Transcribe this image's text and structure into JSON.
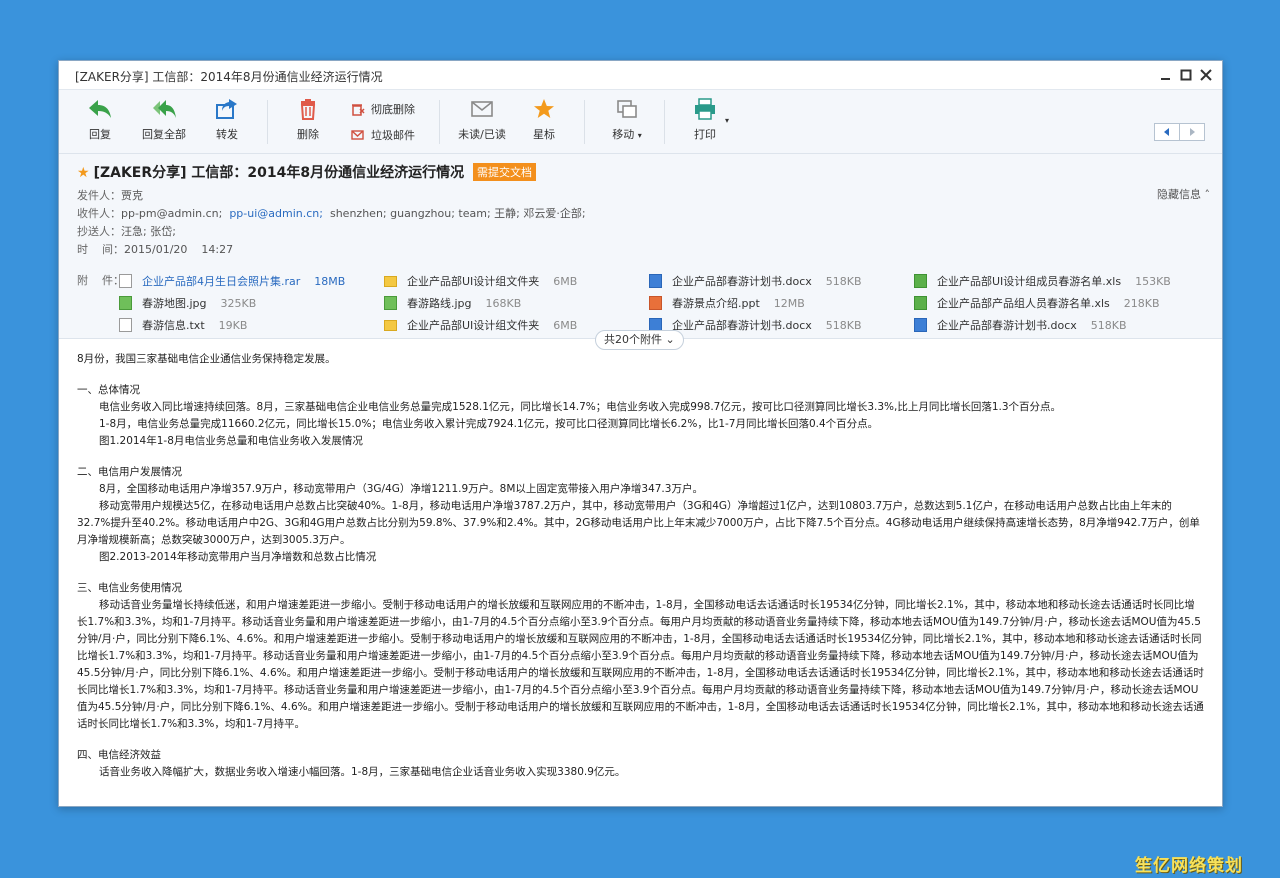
{
  "window": {
    "title": "[ZAKER分享] 工信部：2014年8月份通信业经济运行情况"
  },
  "toolbar": {
    "reply": "回复",
    "reply_all": "回复全部",
    "forward": "转发",
    "delete": "删除",
    "permanent_delete": "彻底删除",
    "junk": "垃圾邮件",
    "unread_read": "未读/已读",
    "star": "星标",
    "move": "移动",
    "print": "打印"
  },
  "mail": {
    "subject": "[ZAKER分享] 工信部：2014年8月份通信业经济运行情况",
    "badge": "需提交文档",
    "hide_info": "隐藏信息",
    "from_label": "发件人：",
    "from": "贾克",
    "to_label": "收件人：",
    "to_1": "pp-pm@admin.cn;",
    "to_2": "pp-ui@admin.cn;",
    "to_rest": "shenzhen;  guangzhou;  team;  王静;  邓云爱·企部;",
    "cc_label": "抄送人：",
    "cc": "汪急;  张岱;",
    "time_label": "时    间：",
    "time": "2015/01/20    14:27",
    "attach_label": "附    件：",
    "attachments_more": "共20个附件"
  },
  "attachments": [
    {
      "name": "企业产品部4月生日会照片集.rar",
      "size": "18MB",
      "type": "rar"
    },
    {
      "name": "企业产品部UI设计组文件夹",
      "size": "6MB",
      "type": "folder"
    },
    {
      "name": "企业产品部春游计划书.docx",
      "size": "518KB",
      "type": "word"
    },
    {
      "name": "企业产品部UI设计组成员春游名单.xls",
      "size": "153KB",
      "type": "excel"
    },
    {
      "name": "春游地图.jpg",
      "size": "325KB",
      "type": "image"
    },
    {
      "name": "春游路线.jpg",
      "size": "168KB",
      "type": "image"
    },
    {
      "name": "春游景点介绍.ppt",
      "size": "12MB",
      "type": "ppt"
    },
    {
      "name": "企业产品部产品组人员春游名单.xls",
      "size": "218KB",
      "type": "excel"
    },
    {
      "name": "春游信息.txt",
      "size": "19KB",
      "type": "text"
    },
    {
      "name": "企业产品部UI设计组文件夹",
      "size": "6MB",
      "type": "folder"
    },
    {
      "name": "企业产品部春游计划书.docx",
      "size": "518KB",
      "type": "word"
    },
    {
      "name": "企业产品部春游计划书.docx",
      "size": "518KB",
      "type": "word"
    }
  ],
  "body": {
    "intro": "8月份，我国三家基础电信企业通信业务保持稳定发展。",
    "s1_title": "一、总体情况",
    "s1_p1": "电信业务收入同比增速持续回落。8月，三家基础电信企业电信业务总量完成1528.1亿元，同比增长14.7%；电信业务收入完成998.7亿元，按可比口径测算同比增长3.3%,比上月同比增长回落1.3个百分点。",
    "s1_p2": "1-8月，电信业务总量完成11660.2亿元，同比增长15.0%；电信业务收入累计完成7924.1亿元，按可比口径测算同比增长6.2%，比1-7月同比增长回落0.4个百分点。",
    "s1_fig": "图1.2014年1-8月电信业务总量和电信业务收入发展情况",
    "s2_title": "二、电信用户发展情况",
    "s2_p1": "8月，全国移动电话用户净增357.9万户，移动宽带用户（3G/4G）净增1211.9万户。8M以上固定宽带接入用户净增347.3万户。",
    "s2_p2": "移动宽带用户规模达5亿，在移动电话用户总数占比突破40%。1-8月，移动电话用户净增3787.2万户，其中，移动宽带用户（3G和4G）净增超过1亿户，达到10803.7万户，总数达到5.1亿户，在移动电话用户总数占比由上年末的32.7%提升至40.2%。移动电话用户中2G、3G和4G用户总数占比分别为59.8%、37.9%和2.4%。其中，2G移动电话用户比上年末减少7000万户，占比下降7.5个百分点。4G移动电话用户继续保持高速增长态势，8月净增942.7万户，创单月净增规模新高；总数突破3000万户，达到3005.3万户。",
    "s2_fig": "图2.2013-2014年移动宽带用户当月净增数和总数占比情况",
    "s3_title": "三、电信业务使用情况",
    "s3_p1": "移动话音业务量增长持续低迷，和用户增速差距进一步缩小。受制于移动电话用户的增长放缓和互联网应用的不断冲击，1-8月，全国移动电话去话通话时长19534亿分钟，同比增长2.1%，其中，移动本地和移动长途去话通话时长同比增长1.7%和3.3%，均和1-7月持平。移动话音业务量和用户增速差距进一步缩小，由1-7月的4.5个百分点缩小至3.9个百分点。每用户月均贡献的移动语音业务量持续下降，移动本地去话MOU值为149.7分钟/月·户，移动长途去话MOU值为45.5分钟/月·户，同比分别下降6.1%、4.6%。和用户增速差距进一步缩小。受制于移动电话用户的增长放缓和互联网应用的不断冲击，1-8月，全国移动电话去话通话时长19534亿分钟，同比增长2.1%，其中，移动本地和移动长途去话通话时长同比增长1.7%和3.3%，均和1-7月持平。移动话音业务量和用户增速差距进一步缩小，由1-7月的4.5个百分点缩小至3.9个百分点。每用户月均贡献的移动语音业务量持续下降，移动本地去话MOU值为149.7分钟/月·户，移动长途去话MOU值为45.5分钟/月·户，同比分别下降6.1%、4.6%。和用户增速差距进一步缩小。受制于移动电话用户的增长放缓和互联网应用的不断冲击，1-8月，全国移动电话去话通话时长19534亿分钟，同比增长2.1%，其中，移动本地和移动长途去话通话时长同比增长1.7%和3.3%，均和1-7月持平。移动话音业务量和用户增速差距进一步缩小，由1-7月的4.5个百分点缩小至3.9个百分点。每用户月均贡献的移动语音业务量持续下降，移动本地去话MOU值为149.7分钟/月·户，移动长途去话MOU值为45.5分钟/月·户，同比分别下降6.1%、4.6%。和用户增速差距进一步缩小。受制于移动电话用户的增长放缓和互联网应用的不断冲击，1-8月，全国移动电话去话通话时长19534亿分钟，同比增长2.1%，其中，移动本地和移动长途去话通话时长同比增长1.7%和3.3%，均和1-7月持平。",
    "s4_title": "四、电信经济效益",
    "s4_p1": "话音业务收入降幅扩大，数据业务收入增速小幅回落。1-8月，三家基础电信企业话音业务收入实现3380.9亿元。"
  },
  "watermark": "笙亿网络策划",
  "colors": {
    "background": "#3a93dc",
    "accent_orange": "#f39a1d",
    "link_blue": "#2a6bc0",
    "reply_green": "#3aa24a"
  }
}
